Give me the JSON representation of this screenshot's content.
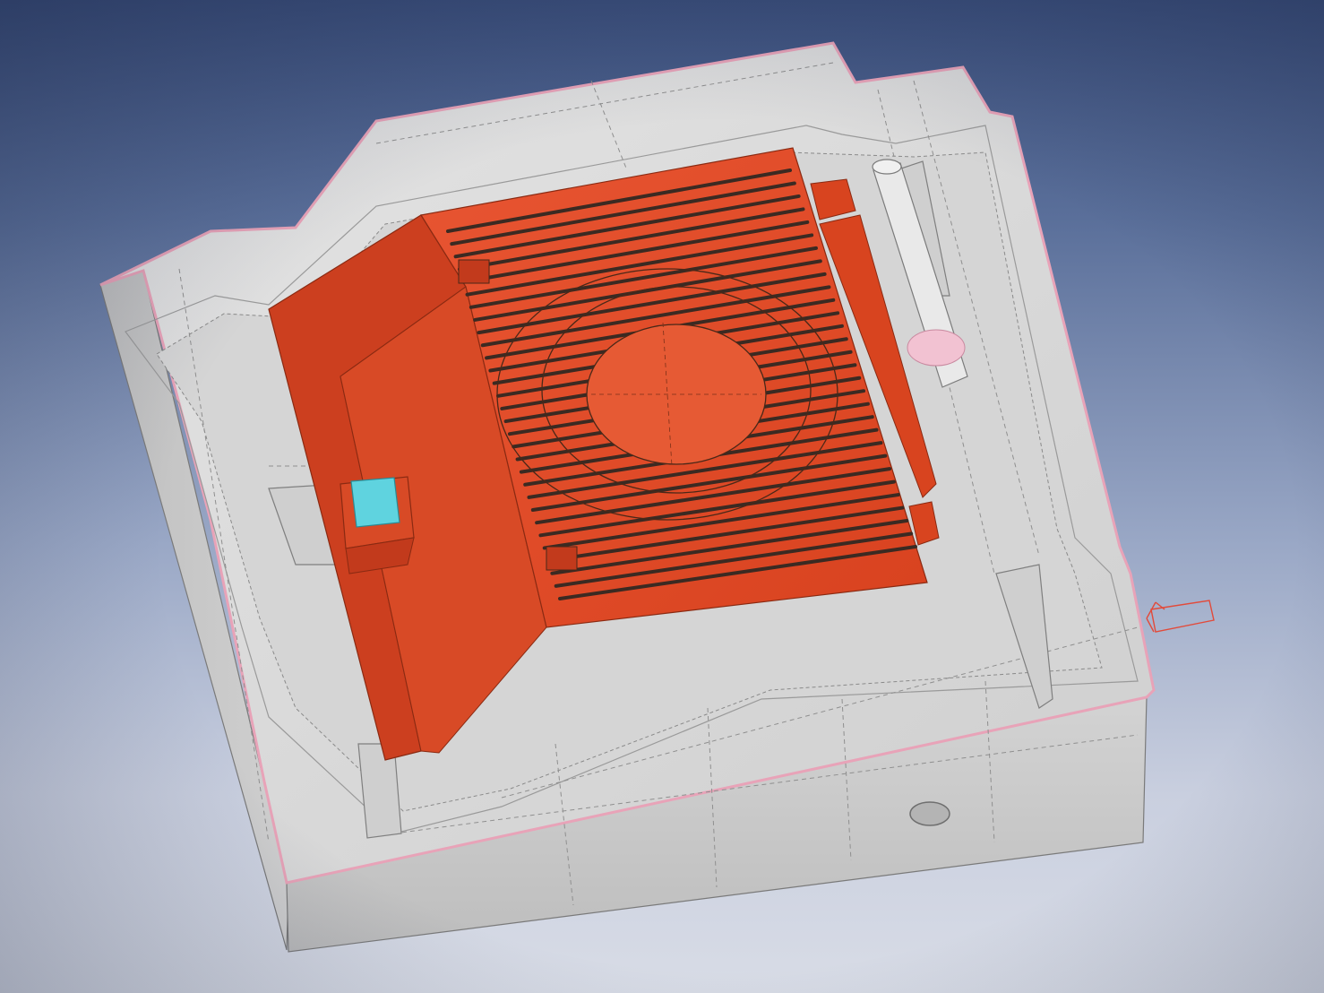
{
  "viewport": {
    "background_top": "#3b4f7c",
    "background_bottom": "#d8dce6"
  },
  "model": {
    "colors": {
      "mold_body": "#d9d9d9",
      "mold_side": "#c4c4c4",
      "mold_edge": "#e8a3b8",
      "cavity_part": "#e14a2a",
      "cavity_part_dark": "#b8391e",
      "rib_slot": "#3b2a22",
      "selected_face": "#5fd3df",
      "ejector_pin": "#e6e6e6",
      "ejector_pin_highlight": "#f2c2d2",
      "triad": "#e24a3a"
    },
    "icons": {
      "coordinate_triad": "coordinate-triad-icon",
      "mounting_hole": "mounting-hole-icon"
    }
  }
}
